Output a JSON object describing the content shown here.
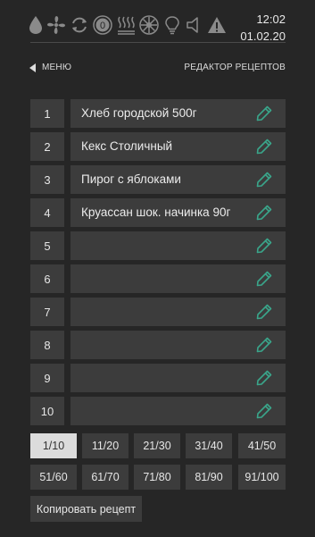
{
  "status": {
    "time": "12:02",
    "date": "01.02.20",
    "icons": [
      "humidity-drop-icon",
      "fan-icon",
      "recirculation-icon",
      "zero-counter-icon",
      "heating-waves-icon",
      "convection-fan-icon",
      "lamp-icon",
      "sound-icon",
      "warning-icon"
    ],
    "counter": "0"
  },
  "nav": {
    "back_label": "МЕНЮ",
    "title": "РЕДАКТОР РЕЦЕПТОВ"
  },
  "recipes": [
    {
      "num": "1",
      "name": "Хлеб городской 500г"
    },
    {
      "num": "2",
      "name": "Кекс Столичный"
    },
    {
      "num": "3",
      "name": "Пирог с яблоками"
    },
    {
      "num": "4",
      "name": "Круассан шок. начинка 90г"
    },
    {
      "num": "5",
      "name": ""
    },
    {
      "num": "6",
      "name": ""
    },
    {
      "num": "7",
      "name": ""
    },
    {
      "num": "8",
      "name": ""
    },
    {
      "num": "9",
      "name": ""
    },
    {
      "num": "10",
      "name": ""
    }
  ],
  "pages": [
    "1/10",
    "11/20",
    "21/30",
    "31/40",
    "41/50",
    "51/60",
    "61/70",
    "71/80",
    "81/90",
    "91/100"
  ],
  "active_page": "1/10",
  "copy_label": "Копировать рецепт",
  "colors": {
    "background": "#262626",
    "tile": "#3c3c3c",
    "accent_edit": "#3aa58a",
    "active_page": "#dcdcdc"
  }
}
